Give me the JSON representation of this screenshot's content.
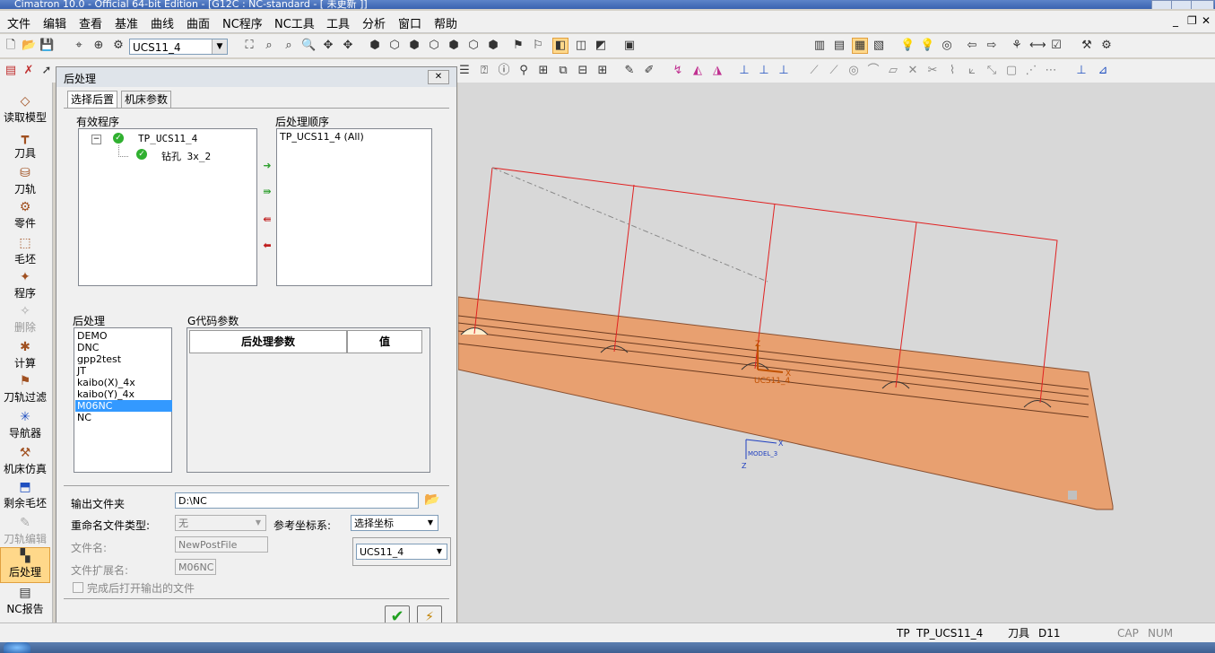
{
  "window": {
    "title": "Cimatron 10.0 - Official 64-bit Edition - [G12C : NC-standard - [ 未更新 ]]"
  },
  "menubar": {
    "items": [
      "文件",
      "编辑",
      "查看",
      "基准",
      "曲线",
      "曲面",
      "NC程序",
      "NC工具",
      "工具",
      "分析",
      "窗口",
      "帮助"
    ]
  },
  "toolbar": {
    "ucs_combo_value": "UCS11_4"
  },
  "sidebar": {
    "items": [
      {
        "label": "读取模型",
        "icon": "read-model-icon"
      },
      {
        "label": "刀具",
        "icon": "tool-icon"
      },
      {
        "label": "刀轨",
        "icon": "toolpath-icon"
      },
      {
        "label": "零件",
        "icon": "part-icon"
      },
      {
        "label": "毛坯",
        "icon": "stock-icon"
      },
      {
        "label": "程序",
        "icon": "procedure-icon"
      },
      {
        "label": "删除",
        "icon": "delete-icon"
      },
      {
        "label": "计算",
        "icon": "execute-icon"
      },
      {
        "label": "刀轨过滤",
        "icon": "filter-icon"
      },
      {
        "label": "导航器",
        "icon": "navigator-icon"
      },
      {
        "label": "机床仿真",
        "icon": "machine-sim-icon"
      },
      {
        "label": "剩余毛坯",
        "icon": "remaining-stock-icon"
      },
      {
        "label": "刀轨编辑",
        "icon": "toolpath-edit-icon"
      },
      {
        "label": "后处理",
        "icon": "post-process-icon"
      },
      {
        "label": "NC报告",
        "icon": "nc-report-icon"
      }
    ]
  },
  "dialog": {
    "title": "后处理",
    "close_label": "✕",
    "tabs": [
      "选择后置",
      "机床参数"
    ],
    "available_label": "有效程序",
    "tree_root": "TP_UCS11_4",
    "tree_child": "钻孔 3x_2",
    "tree_toggle": "−",
    "order_label": "后处理顺序",
    "order_items": [
      "TP_UCS11_4 (All)"
    ],
    "post_label": "后处理",
    "posts": [
      "DEMO",
      "DNC",
      "gpp2test",
      "JT",
      "kaibo(X)_4x",
      "kaibo(Y)_4x",
      "M06NC",
      "NC"
    ],
    "selected_post": "M06NC",
    "gcode_label": "G代码参数",
    "gcode_headers": [
      "后处理参数",
      "值"
    ],
    "output_folder_label": "输出文件夹",
    "output_folder_value": "D:\\NC",
    "rename_type_label": "重命名文件类型:",
    "rename_type_value": "无",
    "ref_coord_label": "参考坐标系:",
    "ref_coord_value": "选择坐标",
    "ucs_value": "UCS11_4",
    "filename_label": "文件名:",
    "filename_value": "NewPostFile",
    "ext_label": "文件扩展名:",
    "ext_value": "M06NC",
    "open_after_label": "完成后打开输出的文件",
    "ok_icon": "checkmark-icon",
    "cancel_icon": "cancel-icon"
  },
  "viewport": {
    "ucs_label": "UCS11_4",
    "model_ucs_label": "MODEL_3",
    "axis_x": "X",
    "axis_z": "Z"
  },
  "statusbar": {
    "tp_label": "TP",
    "tp_value": "TP_UCS11_4",
    "tool_label": "刀具",
    "tool_value": "D11",
    "cap": "CAP",
    "num": "NUM"
  },
  "colors": {
    "part_fill": "#e8a070",
    "wire": "#e02020",
    "selection": "#3399ff"
  }
}
